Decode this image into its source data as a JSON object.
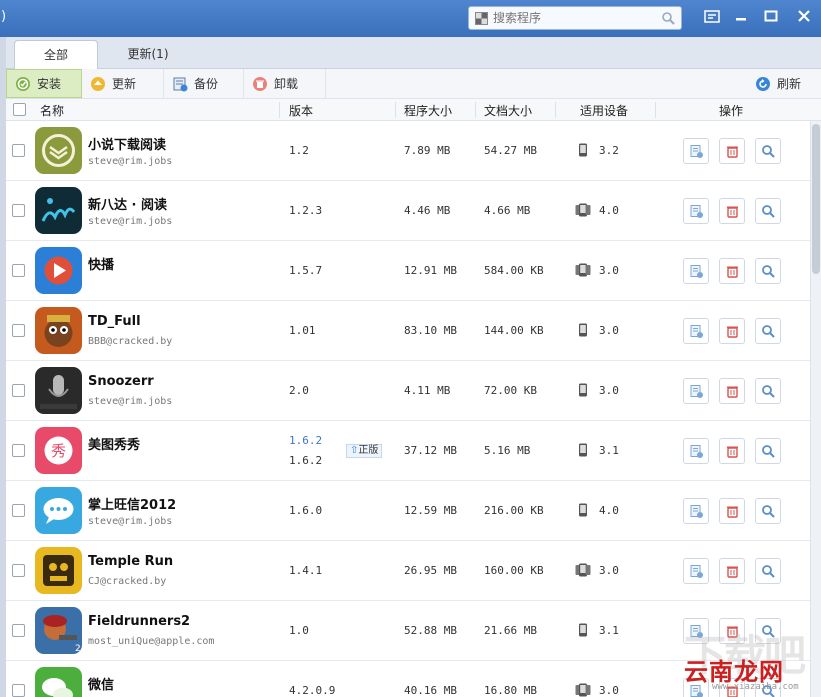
{
  "titlebar": {
    "fragment": ")",
    "search_placeholder": "搜索程序"
  },
  "tabs": [
    {
      "label": "全部",
      "active": true
    },
    {
      "label": "更新(1)",
      "active": false
    }
  ],
  "toolbar": {
    "install": "安装",
    "update": "更新",
    "backup": "备份",
    "uninstall": "卸载",
    "refresh": "刷新"
  },
  "columns": {
    "name": "名称",
    "version": "版本",
    "app_size": "程序大小",
    "doc_size": "文档大小",
    "device": "适用设备",
    "actions": "操作"
  },
  "apps": [
    {
      "name": "小说下载阅读",
      "author": "steve@rim.jobs",
      "version": "1.2",
      "app_size": "7.89 MB",
      "doc_size": "54.27 MB",
      "device_type": "phone",
      "device": "3.2",
      "icon": "book-icon"
    },
    {
      "name": "新八达 · 阅读",
      "author": "steve@rim.jobs",
      "version": "1.2.3",
      "app_size": "4.46 MB",
      "doc_size": "4.66 MB",
      "device_type": "multi",
      "device": "4.0",
      "icon": "badar-icon"
    },
    {
      "name": "快播",
      "author": "",
      "version": "1.5.7",
      "app_size": "12.91 MB",
      "doc_size": "584.00 KB",
      "device_type": "multi",
      "device": "3.0",
      "icon": "qvod-icon"
    },
    {
      "name": "TD_Full",
      "author": "BBB@cracked.by",
      "version": "1.01",
      "app_size": "83.10 MB",
      "doc_size": "144.00 KB",
      "device_type": "phone",
      "device": "3.0",
      "icon": "monkey-icon"
    },
    {
      "name": "Snoozerr",
      "author": "steve@rim.jobs",
      "version": "2.0",
      "app_size": "4.11 MB",
      "doc_size": "72.00 KB",
      "device_type": "phone",
      "device": "3.0",
      "icon": "microphone-icon"
    },
    {
      "name": "美图秀秀",
      "author": "",
      "version_new": "1.6.2",
      "version": "1.6.2",
      "badge": "正版",
      "app_size": "37.12 MB",
      "doc_size": "5.16 MB",
      "device_type": "phone",
      "device": "3.1",
      "icon": "meitu-icon"
    },
    {
      "name": "掌上旺信2012",
      "author": "steve@rim.jobs",
      "version": "1.6.0",
      "app_size": "12.59 MB",
      "doc_size": "216.00 KB",
      "device_type": "phone",
      "device": "4.0",
      "icon": "chat-bubble-icon"
    },
    {
      "name": "Temple Run",
      "author": "CJ@cracked.by",
      "version": "1.4.1",
      "app_size": "26.95 MB",
      "doc_size": "160.00 KB",
      "device_type": "multi",
      "device": "3.0",
      "icon": "temple-icon"
    },
    {
      "name": "Fieldrunners2",
      "author": "most_uniQue@apple.com",
      "version": "1.0",
      "app_size": "52.88 MB",
      "doc_size": "21.66 MB",
      "device_type": "phone",
      "device": "3.1",
      "icon": "soldier-icon"
    },
    {
      "name": "微信",
      "author": "",
      "version": "4.2.0.9",
      "app_size": "40.16 MB",
      "doc_size": "16.80 MB",
      "device_type": "multi",
      "device": "3.0",
      "icon": "wechat-icon"
    }
  ],
  "watermark": {
    "big": "下载吧",
    "red": "云南龙网",
    "url": "www.xiazaiba.com"
  }
}
